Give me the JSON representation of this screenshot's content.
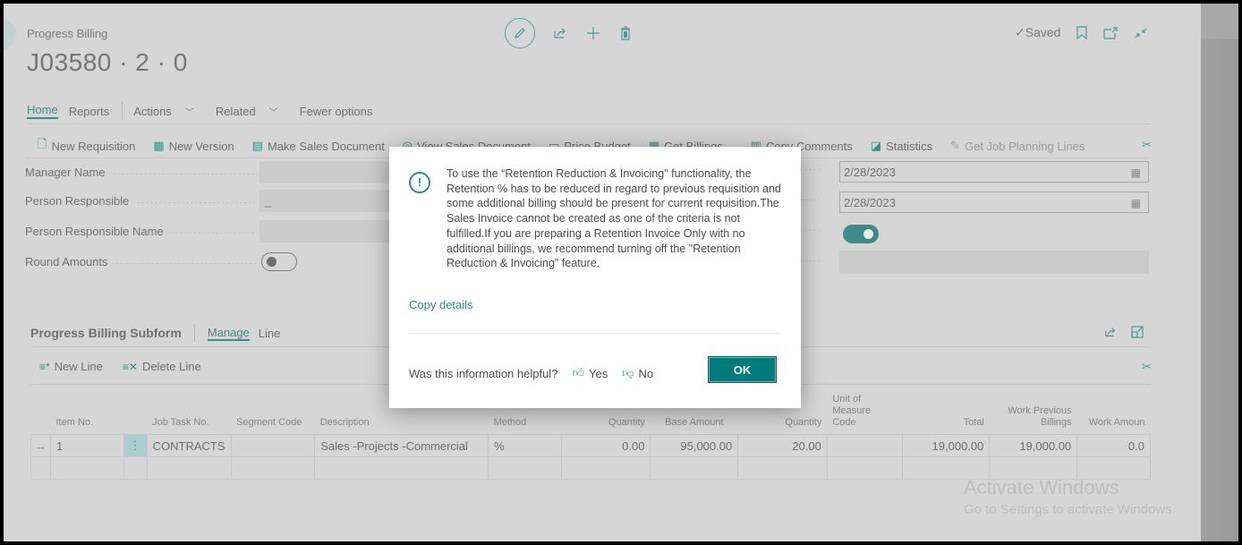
{
  "header": {
    "breadcrumb": "Progress Billing",
    "title": "J03580 · 2 · 0",
    "status": "Saved",
    "top_icons": [
      "edit-icon",
      "share-icon",
      "add-icon",
      "delete-icon"
    ],
    "right_icons": [
      "bookmark-icon",
      "open-new-window-icon",
      "collapse-icon"
    ]
  },
  "menu": {
    "items": [
      {
        "label": "Home",
        "active": true
      },
      {
        "label": "Reports"
      },
      {
        "label": "Actions",
        "dropdown": true
      },
      {
        "label": "Related",
        "dropdown": true
      },
      {
        "label": "Fewer options"
      }
    ]
  },
  "actions": [
    {
      "label": "New Requisition",
      "icon": "new-document-icon"
    },
    {
      "label": "New Version",
      "icon": "new-version-icon"
    },
    {
      "label": "Make Sales Document",
      "icon": "make-document-icon"
    },
    {
      "label": "View Sales Document",
      "icon": "view-icon"
    },
    {
      "label": "Price Budget",
      "icon": "budget-icon"
    },
    {
      "label": "Get Billings...",
      "icon": "get-billings-icon"
    },
    {
      "label": "Copy Comments",
      "icon": "copy-comments-icon"
    },
    {
      "label": "Statistics",
      "icon": "statistics-icon"
    },
    {
      "label": "Get Job Planning Lines",
      "icon": "get-lines-icon",
      "disabled": true
    }
  ],
  "fields_left": [
    {
      "label": "Manager Name",
      "value": ""
    },
    {
      "label": "Person Responsible",
      "value": "_"
    },
    {
      "label": "Person Responsible Name",
      "value": ""
    },
    {
      "label": "Round Amounts",
      "type": "toggle",
      "on": false
    }
  ],
  "fields_right": [
    {
      "value": "2/28/2023",
      "type": "date"
    },
    {
      "value": "2/28/2023",
      "type": "date"
    },
    {
      "type": "toggle",
      "on": true
    },
    {
      "value": ""
    }
  ],
  "subform": {
    "title": "Progress Billing Subform",
    "tabs": [
      {
        "label": "Manage",
        "active": true
      },
      {
        "label": "Line"
      }
    ],
    "actions": [
      {
        "label": "New Line",
        "icon": "new-line-icon"
      },
      {
        "label": "Delete Line",
        "icon": "delete-line-icon"
      }
    ],
    "columns": [
      "",
      "Item No.",
      "",
      "Job Task No.",
      "Segment Code",
      "Description",
      "Method",
      "Quantity",
      "Base Amount",
      "Quantity",
      "Unit of Measure Code",
      "Total",
      "Work Previous Billings",
      "Work Amoun"
    ],
    "rows": [
      {
        "arrow": "→",
        "item_no": "1",
        "job_task_no": "CONTRACTS",
        "segment_code": "",
        "description": "Sales -Projects -Commercial",
        "method": "%",
        "quantity": "0.00",
        "base_amount": "95,000.00",
        "quantity2": "20.00",
        "uom": "",
        "total": "19,000.00",
        "work_prev": "19,000.00",
        "work_amount": "0.0"
      },
      {
        "arrow": "",
        "item_no": "",
        "job_task_no": "",
        "segment_code": "",
        "description": "",
        "method": "",
        "quantity": "",
        "base_amount": "",
        "quantity2": "",
        "uom": "",
        "total": "",
        "work_prev": "",
        "work_amount": ""
      }
    ]
  },
  "dialog": {
    "message": "To use the “Retention Reduction & Invoicing\" functionality, the Retention % has to be reduced in regard to previous requisition and some additional billing should be present for current requisition.The Sales Invoice cannot be created as one of the criteria is not fulfilled.If you are preparing a Retention Invoice Only with no additional billings, we recommend turning off the \"Retention Reduction & Invoicing\" feature.",
    "copy_details": "Copy details",
    "feedback_question": "Was this information helpful?",
    "yes": "Yes",
    "no": "No",
    "ok": "OK"
  },
  "watermark": {
    "line1": "Activate Windows",
    "line2": "Go to Settings to activate Windows."
  },
  "colors": {
    "accent": "#3d8c8c",
    "ok_button": "#007b7b",
    "background": "#d6d6d6"
  }
}
